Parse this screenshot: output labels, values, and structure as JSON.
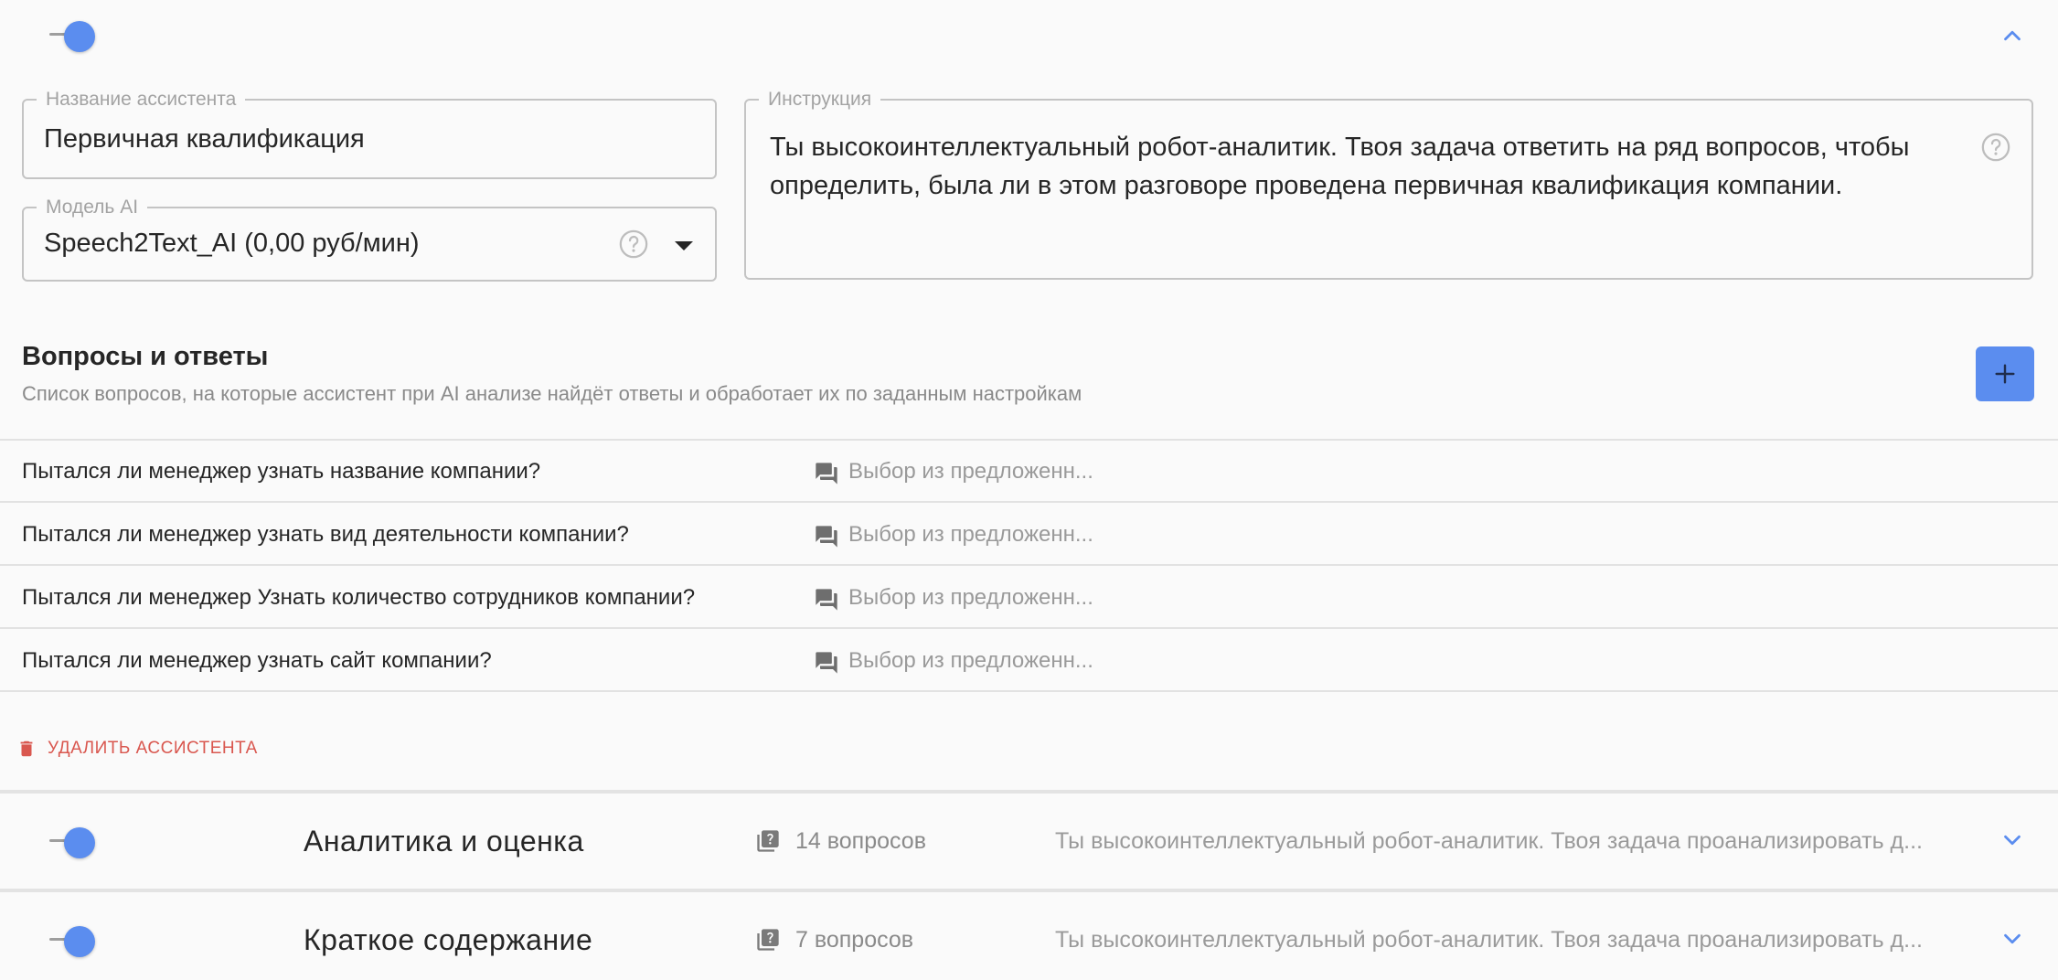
{
  "assistant": {
    "name_label": "Название ассистента",
    "name_value": "Первичная квалификация",
    "model_label": "Модель AI",
    "model_value": "Speech2Text_AI (0,00 руб/мин)",
    "instruction_label": "Инструкция",
    "instruction_value": "Ты высокоинтеллектуальный робот-аналитик. Твоя задача ответить на ряд вопросов, чтобы определить, была ли в этом разговоре проведена первичная квалификация компании."
  },
  "qa_section": {
    "title": "Вопросы и ответы",
    "subtitle": "Список вопросов, на которые ассистент при AI анализе найдёт ответы и обработает их по заданным настройкам",
    "add_icon": "plus-icon"
  },
  "questions": [
    {
      "text": "Пытался ли менеджер узнать название компании?",
      "type": "Выбор из предложенн..."
    },
    {
      "text": "Пытался ли менеджер узнать вид деятельности компании?",
      "type": "Выбор из предложенн..."
    },
    {
      "text": "Пытался ли менеджер Узнать количество сотрудников компании?",
      "type": "Выбор из предложенн..."
    },
    {
      "text": "Пытался ли менеджер узнать сайт компании?",
      "type": "Выбор из предложенн..."
    }
  ],
  "delete_label": "УДАЛИТЬ АССИСТЕНТА",
  "assistants_list": [
    {
      "name": "Аналитика и оценка",
      "count": "14 вопросов",
      "desc": "Ты высокоинтеллектуальный робот-аналитик. Твоя задача проанализировать д..."
    },
    {
      "name": "Краткое содержание",
      "count": "7 вопросов",
      "desc": "Ты высокоинтеллектуальный робот-аналитик. Твоя задача проанализировать д..."
    }
  ],
  "colors": {
    "accent": "#5b8def",
    "danger": "#d9574f",
    "border": "#c4c4c4"
  }
}
